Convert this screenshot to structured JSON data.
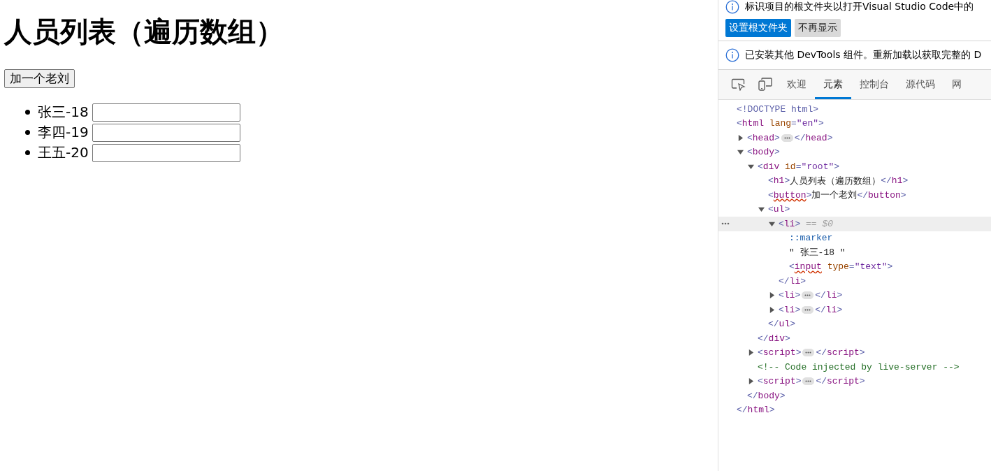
{
  "page": {
    "heading": "人员列表（遍历数组）",
    "add_button": "加一个老刘",
    "people": [
      {
        "label": "张三-18"
      },
      {
        "label": "李四-19"
      },
      {
        "label": "王五-20"
      }
    ]
  },
  "devtools": {
    "infobars": [
      {
        "message": "标识项目的根文件夹以打开Visual Studio Code中的",
        "buttons": [
          {
            "label": "设置根文件夹",
            "kind": "primary"
          },
          {
            "label": "不再显示",
            "kind": "secondary"
          }
        ]
      },
      {
        "message": "已安装其他 DevTools 组件。重新加载以获取完整的 D"
      }
    ],
    "tabs": [
      {
        "kind": "inspect",
        "selected": false
      },
      {
        "kind": "device",
        "selected": false
      },
      {
        "kind": "text",
        "label": "欢迎",
        "selected": false
      },
      {
        "kind": "text",
        "label": "元素",
        "selected": true
      },
      {
        "kind": "text",
        "label": "控制台",
        "selected": false
      },
      {
        "kind": "text",
        "label": "源代码",
        "selected": false
      },
      {
        "kind": "text",
        "label": "网",
        "selected": false
      }
    ],
    "tree": [
      {
        "open": [
          {
            "kind": "punct",
            "text": "<!DOCTYPE html>"
          }
        ],
        "selected": false
      },
      {
        "open": [
          {
            "kind": "punct",
            "text": "<"
          },
          {
            "kind": "tag",
            "text": "html"
          },
          {
            "kind": "attr",
            "text": " lang"
          },
          {
            "kind": "punct",
            "text": "="
          },
          {
            "kind": "value",
            "text": "\"en\""
          },
          {
            "kind": "punct",
            "text": ">"
          }
        ],
        "selected": false,
        "close": [
          {
            "kind": "punct",
            "text": "</"
          },
          {
            "kind": "tag",
            "text": "html"
          },
          {
            "kind": "punct",
            "text": ">"
          }
        ],
        "children": [
          {
            "open": [
              {
                "kind": "punct",
                "text": "<"
              },
              {
                "kind": "tag",
                "text": "head"
              },
              {
                "kind": "punct",
                "text": ">"
              }
            ],
            "expanded": false,
            "selected": false,
            "close": [
              {
                "kind": "punct",
                "text": "</"
              },
              {
                "kind": "tag",
                "text": "head"
              },
              {
                "kind": "punct",
                "text": ">"
              }
            ]
          },
          {
            "open": [
              {
                "kind": "punct",
                "text": "<"
              },
              {
                "kind": "tag",
                "text": "body"
              },
              {
                "kind": "punct",
                "text": ">"
              }
            ],
            "expanded": true,
            "selected": false,
            "close": [
              {
                "kind": "punct",
                "text": "</"
              },
              {
                "kind": "tag",
                "text": "body"
              },
              {
                "kind": "punct",
                "text": ">"
              }
            ],
            "children": [
              {
                "open": [
                  {
                    "kind": "punct",
                    "text": "<"
                  },
                  {
                    "kind": "tag",
                    "text": "div"
                  },
                  {
                    "kind": "attr",
                    "text": " id"
                  },
                  {
                    "kind": "punct",
                    "text": "="
                  },
                  {
                    "kind": "value",
                    "text": "\"root\""
                  },
                  {
                    "kind": "punct",
                    "text": ">"
                  }
                ],
                "expanded": true,
                "selected": false,
                "close": [
                  {
                    "kind": "punct",
                    "text": "</"
                  },
                  {
                    "kind": "tag",
                    "text": "div"
                  },
                  {
                    "kind": "punct",
                    "text": ">"
                  }
                ],
                "children": [
                  {
                    "open": [
                      {
                        "kind": "punct",
                        "text": "<"
                      },
                      {
                        "kind": "tag",
                        "text": "h1"
                      },
                      {
                        "kind": "punct",
                        "text": ">"
                      },
                      {
                        "kind": "text",
                        "text": "人员列表（遍历数组）"
                      },
                      {
                        "kind": "punct",
                        "text": "</"
                      },
                      {
                        "kind": "tag",
                        "text": "h1"
                      },
                      {
                        "kind": "punct",
                        "text": ">"
                      }
                    ],
                    "selected": false
                  },
                  {
                    "open": [
                      {
                        "kind": "punct",
                        "text": "<"
                      },
                      {
                        "kind": "flagged",
                        "text": "button"
                      },
                      {
                        "kind": "punct",
                        "text": ">"
                      },
                      {
                        "kind": "text",
                        "text": "加一个老刘"
                      },
                      {
                        "kind": "punct",
                        "text": "</"
                      },
                      {
                        "kind": "tag",
                        "text": "button"
                      },
                      {
                        "kind": "punct",
                        "text": ">"
                      }
                    ],
                    "selected": false
                  },
                  {
                    "open": [
                      {
                        "kind": "punct",
                        "text": "<"
                      },
                      {
                        "kind": "tag",
                        "text": "ul"
                      },
                      {
                        "kind": "punct",
                        "text": ">"
                      }
                    ],
                    "expanded": true,
                    "selected": false,
                    "close": [
                      {
                        "kind": "punct",
                        "text": "</"
                      },
                      {
                        "kind": "tag",
                        "text": "ul"
                      },
                      {
                        "kind": "punct",
                        "text": ">"
                      }
                    ],
                    "children": [
                      {
                        "open": [
                          {
                            "kind": "punct",
                            "text": "<"
                          },
                          {
                            "kind": "tag",
                            "text": "li"
                          },
                          {
                            "kind": "punct",
                            "text": ">"
                          },
                          {
                            "kind": "hint",
                            "text": " == $0"
                          }
                        ],
                        "expanded": true,
                        "selected": true,
                        "close": [
                          {
                            "kind": "punct",
                            "text": "</"
                          },
                          {
                            "kind": "tag",
                            "text": "li"
                          },
                          {
                            "kind": "punct",
                            "text": ">"
                          }
                        ],
                        "children": [
                          {
                            "open": [
                              {
                                "kind": "pseudo",
                                "text": "::marker"
                              }
                            ],
                            "selected": false
                          },
                          {
                            "open": [
                              {
                                "kind": "text",
                                "text": "\" 张三-18 \""
                              }
                            ],
                            "selected": false
                          },
                          {
                            "open": [
                              {
                                "kind": "punct",
                                "text": "<"
                              },
                              {
                                "kind": "flagged",
                                "text": "input"
                              },
                              {
                                "kind": "attr",
                                "text": " type"
                              },
                              {
                                "kind": "punct",
                                "text": "="
                              },
                              {
                                "kind": "value",
                                "text": "\"text\""
                              },
                              {
                                "kind": "punct",
                                "text": ">"
                              }
                            ],
                            "selected": false
                          }
                        ]
                      },
                      {
                        "open": [
                          {
                            "kind": "punct",
                            "text": "<"
                          },
                          {
                            "kind": "tag",
                            "text": "li"
                          },
                          {
                            "kind": "punct",
                            "text": ">"
                          }
                        ],
                        "expanded": false,
                        "selected": false,
                        "close": [
                          {
                            "kind": "punct",
                            "text": "</"
                          },
                          {
                            "kind": "tag",
                            "text": "li"
                          },
                          {
                            "kind": "punct",
                            "text": ">"
                          }
                        ]
                      },
                      {
                        "open": [
                          {
                            "kind": "punct",
                            "text": "<"
                          },
                          {
                            "kind": "tag",
                            "text": "li"
                          },
                          {
                            "kind": "punct",
                            "text": ">"
                          }
                        ],
                        "expanded": false,
                        "selected": false,
                        "close": [
                          {
                            "kind": "punct",
                            "text": "</"
                          },
                          {
                            "kind": "tag",
                            "text": "li"
                          },
                          {
                            "kind": "punct",
                            "text": ">"
                          }
                        ]
                      }
                    ]
                  }
                ]
              },
              {
                "open": [
                  {
                    "kind": "punct",
                    "text": "<"
                  },
                  {
                    "kind": "tag",
                    "text": "script"
                  },
                  {
                    "kind": "punct",
                    "text": ">"
                  }
                ],
                "expanded": false,
                "selected": false,
                "close": [
                  {
                    "kind": "punct",
                    "text": "</"
                  },
                  {
                    "kind": "tag",
                    "text": "script"
                  },
                  {
                    "kind": "punct",
                    "text": ">"
                  }
                ]
              },
              {
                "open": [
                  {
                    "kind": "comment",
                    "text": "<!-- Code injected by live-server -->"
                  }
                ],
                "selected": false
              },
              {
                "open": [
                  {
                    "kind": "punct",
                    "text": "<"
                  },
                  {
                    "kind": "tag",
                    "text": "script"
                  },
                  {
                    "kind": "punct",
                    "text": ">"
                  }
                ],
                "expanded": false,
                "selected": false,
                "close": [
                  {
                    "kind": "punct",
                    "text": "</"
                  },
                  {
                    "kind": "tag",
                    "text": "script"
                  },
                  {
                    "kind": "punct",
                    "text": ">"
                  }
                ]
              }
            ]
          }
        ]
      }
    ]
  }
}
